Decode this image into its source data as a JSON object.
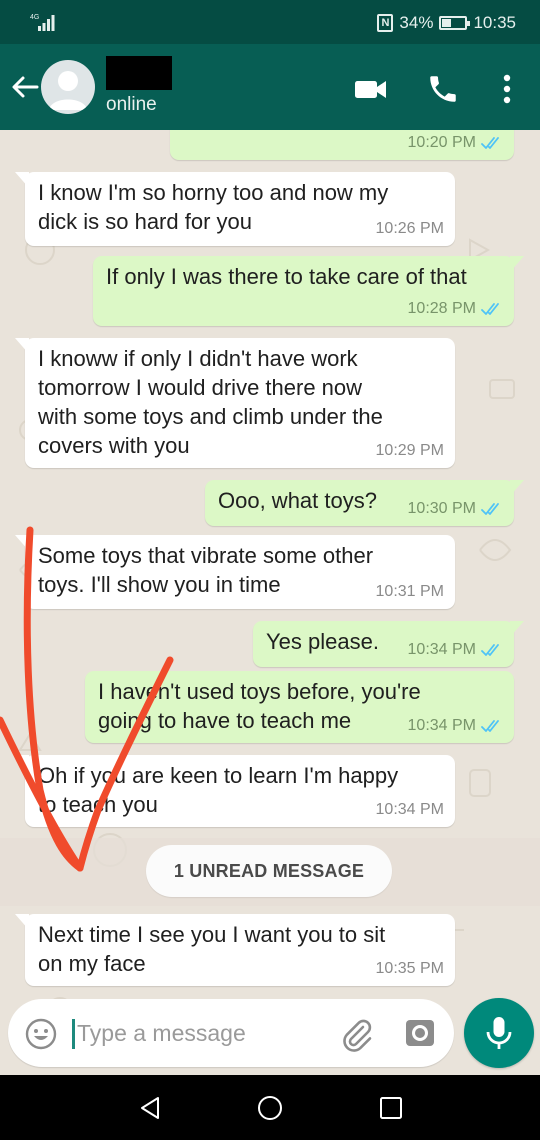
{
  "status_bar": {
    "signal": "4G",
    "battery": "34%",
    "time": "10:35",
    "icons": [
      "signal-icon",
      "nfc-icon",
      "battery-icon"
    ]
  },
  "header": {
    "status": "online",
    "icons": [
      "back-arrow-icon",
      "avatar",
      "video-call-icon",
      "phone-call-icon",
      "more-options-icon"
    ]
  },
  "messages": [
    {
      "dir": "out",
      "text": "",
      "time": "10:20 PM",
      "read": true
    },
    {
      "dir": "in",
      "text": "I know I'm so horny too and now my\ndick is so hard for you",
      "time": "10:26 PM"
    },
    {
      "dir": "out",
      "text": "If only I was there to take care of that",
      "time": "10:28 PM",
      "read": true
    },
    {
      "dir": "in",
      "text": "I knoww if only I didn't have work\ntomorrow I would drive there now\nwith some toys and climb under the\ncovers with you",
      "time": "10:29 PM"
    },
    {
      "dir": "out",
      "text": "Ooo, what toys?",
      "time": "10:30 PM",
      "read": true
    },
    {
      "dir": "in",
      "text": "Some toys that vibrate some other\ntoys.  I'll show you in time",
      "time": "10:31 PM"
    },
    {
      "dir": "out",
      "text": "Yes please.",
      "time": "10:34 PM",
      "read": true
    },
    {
      "dir": "out",
      "text": "I haven't used toys before, you're\ngoing to have to teach me",
      "time": "10:34 PM",
      "read": true
    },
    {
      "dir": "in",
      "text": "Oh if you are keen to learn I'm happy\nto teach you",
      "time": "10:34 PM"
    },
    {
      "dir": "in",
      "text": "Next time I see you I want you to sit\non my face",
      "time": "10:35 PM"
    }
  ],
  "unread_label": "1 UNREAD MESSAGE",
  "composer": {
    "placeholder": "Type a message"
  },
  "colors": {
    "header": "#075e54",
    "status_bar": "#054c43",
    "outgoing_bubble": "#dcf8c6",
    "incoming_bubble": "#ffffff",
    "read_ticks": "#4fc3f7",
    "fab": "#00897b",
    "annotation": "#f04b2c"
  }
}
